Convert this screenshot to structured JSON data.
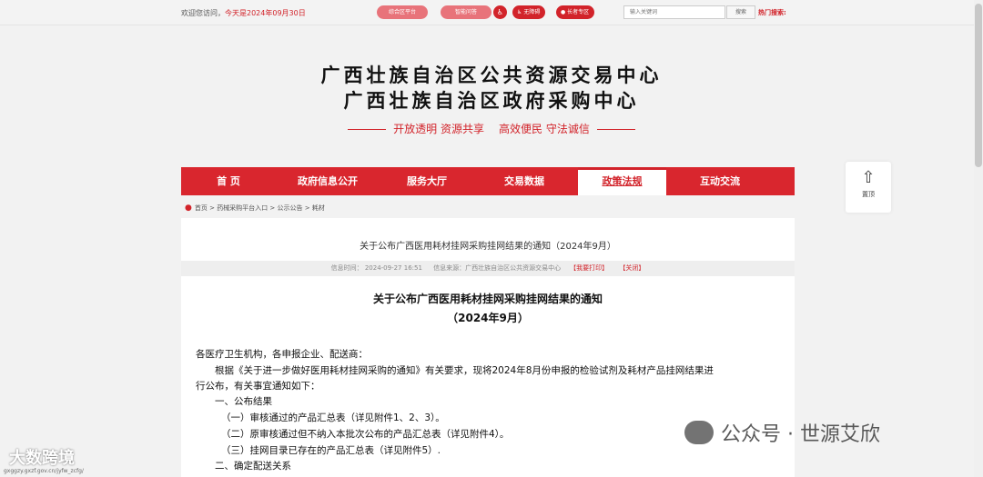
{
  "topbar": {
    "welcome_prefix": "欢迎您访问，",
    "date_text": "今天是2024年09月30日",
    "pill1": "综合区平台",
    "pill2": "智能问答",
    "accessibility_icon_glyph": "♿",
    "accessibility_label": "无障碍",
    "elder_label": "长者专区",
    "search_placeholder": "输入关键词",
    "search_button": "搜索",
    "hot_search": "热门搜索:"
  },
  "header": {
    "title_line1": "广西壮族自治区公共资源交易中心",
    "title_line2": "广西壮族自治区政府采购中心",
    "slogan1": "开放透明 资源共享",
    "slogan2": "高效便民 守法诚信"
  },
  "nav": {
    "items": [
      "首 页",
      "政府信息公开",
      "服务大厅",
      "交易数据",
      "政策法规",
      "互动交流"
    ],
    "active_index": 4
  },
  "totop": {
    "label": "置顶",
    "icon": "up-arrow-icon"
  },
  "breadcrumb": {
    "home": "首页",
    "level1": "药械采购平台入口",
    "level2": "公示公告",
    "level3": "耗材",
    "sep": " > "
  },
  "article": {
    "title": "关于公布广西医用耗材挂网采购挂网结果的通知（2024年9月）",
    "meta_time": "信息时间：  2024-09-27 16:51",
    "meta_source": "信息来源：广西壮族自治区公共资源交易中心",
    "meta_print": "【我要打印】",
    "meta_close": "【关闭】",
    "heading_line1": "关于公布广西医用耗材挂网采购挂网结果的通知",
    "heading_line2": "（2024年9月）",
    "paragraphs": [
      "各医疗卫生机构，各申报企业、配送商：",
      "根据《关于进一步做好医用耗材挂网采购的通知》有关要求，现将2024年8月份申报的检验试剂及耗材产品挂网结果进",
      "行公布，有关事宜通知如下：",
      "一、公布结果",
      "（一）审核通过的产品汇总表（详见附件1、2、3）。",
      "（二）原审核通过但不纳入本批次公布的产品汇总表（详见附件4）。",
      "（三）挂网目录已存在的产品汇总表（详见附件5）.",
      "二、确定配送关系"
    ]
  },
  "watermarks": {
    "right": "公众号 · 世源艾欣",
    "left": "大数跨境",
    "url": "gxggzy.gxzf.gov.cn/jyfw_zcfg/"
  },
  "colors": {
    "brand_red": "#d9262e",
    "pill_pink": "#e8737a"
  }
}
